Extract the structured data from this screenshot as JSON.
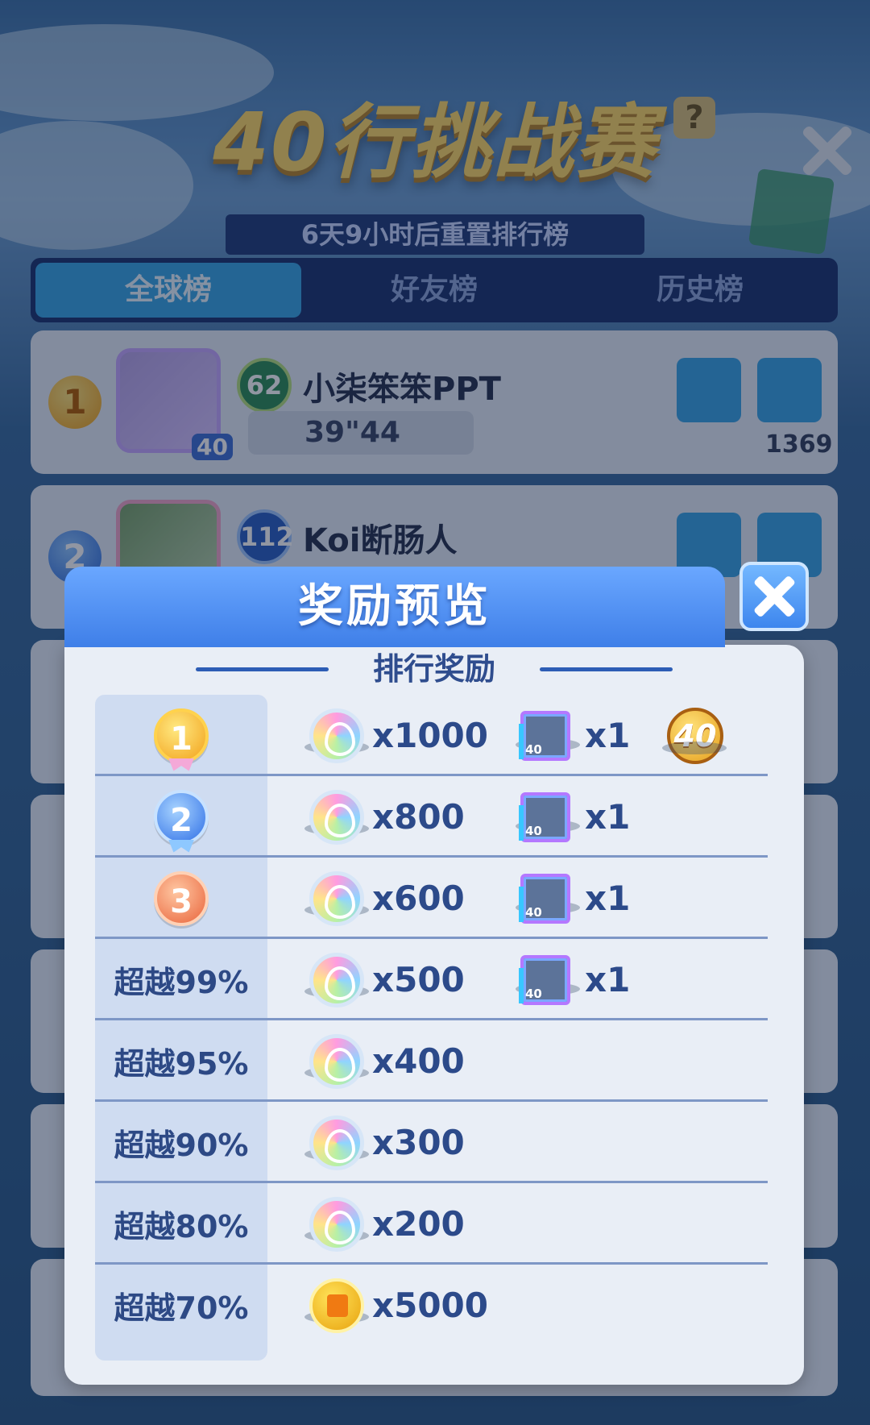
{
  "background": {
    "title": "40行挑战赛",
    "help_label": "?",
    "reset_text": "6天9小时后重置排行榜",
    "tabs": [
      "全球榜",
      "好友榜",
      "历史榜"
    ],
    "entries": [
      {
        "rank": "1",
        "level": "62",
        "name": "小柒笨笨PPT",
        "time": "39\"44",
        "avatar_level": "40",
        "likes": "1369"
      },
      {
        "rank": "2",
        "level": "112",
        "name": "Koi断肠人"
      }
    ]
  },
  "modal": {
    "title": "奖励预览",
    "section_title": "排行奖励",
    "rows": [
      {
        "rank_type": "medal",
        "rank": "1",
        "medal": "gold",
        "gem_amount": "x1000",
        "frame_amount": "x1",
        "frame_tag": "40",
        "trophy": "40"
      },
      {
        "rank_type": "medal",
        "rank": "2",
        "medal": "silver",
        "gem_amount": "x800",
        "frame_amount": "x1",
        "frame_tag": "40"
      },
      {
        "rank_type": "medal",
        "rank": "3",
        "medal": "bronze",
        "gem_amount": "x600",
        "frame_amount": "x1",
        "frame_tag": "40"
      },
      {
        "rank_type": "text",
        "rank": "超越99%",
        "gem_amount": "x500",
        "frame_amount": "x1",
        "frame_tag": "40"
      },
      {
        "rank_type": "text",
        "rank": "超越95%",
        "gem_amount": "x400"
      },
      {
        "rank_type": "text",
        "rank": "超越90%",
        "gem_amount": "x300"
      },
      {
        "rank_type": "text",
        "rank": "超越80%",
        "gem_amount": "x200"
      },
      {
        "rank_type": "text",
        "rank": "超越70%",
        "coin_amount": "x5000"
      }
    ]
  },
  "colors": {
    "modal_header": "#3f7fe8",
    "modal_body": "#e9eef6",
    "rank_column": "#cfdcf1",
    "amount_text": "#2c4a8a"
  },
  "icons": {
    "gem": "rainbow-gem-icon",
    "frame": "avatar-frame-icon",
    "coin": "gold-coin-icon",
    "trophy": "40-line-trophy-icon",
    "close": "close-icon"
  }
}
